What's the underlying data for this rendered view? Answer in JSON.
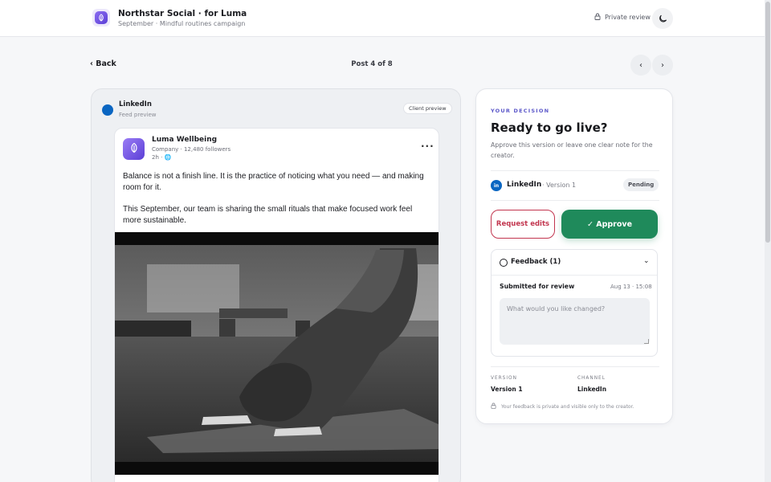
{
  "header": {
    "title": "Northstar Social · for Luma",
    "subtitle": "September · Mindful routines campaign",
    "private_label": "Private review",
    "icons": {
      "brand": "leaf-icon",
      "lock": "lock-icon",
      "theme": "moon-icon"
    }
  },
  "nav": {
    "back_label": "‹ Back",
    "post_position": "Post 4 of 8",
    "prev_label": "‹",
    "next_label": "›"
  },
  "preview": {
    "platform": "LinkedIn",
    "subtitle": "Feed preview",
    "badge": "Client preview",
    "post": {
      "author": "Luma Wellbeing",
      "author_meta": "Company · 12,480 followers",
      "time": "2h · 🌐",
      "more_label": "···",
      "paragraphs": [
        "Balance is not a finish line. It is the practice of noticing what you need — and making room for it.",
        "This September, our team is sharing the small rituals that make focused work feel more sustainable."
      ],
      "image_alt": "Black and white photo of a person in downward dog yoga pose on a mat"
    }
  },
  "decision": {
    "eyebrow": "YOUR DECISION",
    "headline": "Ready to go live?",
    "description": "Approve this version or leave one clear note for the creator.",
    "platform_badge": "in",
    "platform": "LinkedIn",
    "version_text": "· Version 1",
    "status": "Pending",
    "request_label": "Request edits",
    "approve_label": "✓ Approve",
    "feedback": {
      "title": "Feedback (1)",
      "chevron": "⌄",
      "entry_title": "Submitted for review",
      "entry_date": "Aug 13 · 15:08",
      "placeholder": "What would you like changed?"
    },
    "meta": {
      "version_label": "VERSION",
      "version_value": "Version 1",
      "channel_label": "CHANNEL",
      "channel_value": "LinkedIn"
    },
    "privacy_note": "Your feedback is private and visible only to the creator."
  },
  "colors": {
    "accent": "#5b57c9",
    "approve": "#1f8a5b",
    "request": "#c2364f",
    "linkedin": "#0a66c2"
  }
}
